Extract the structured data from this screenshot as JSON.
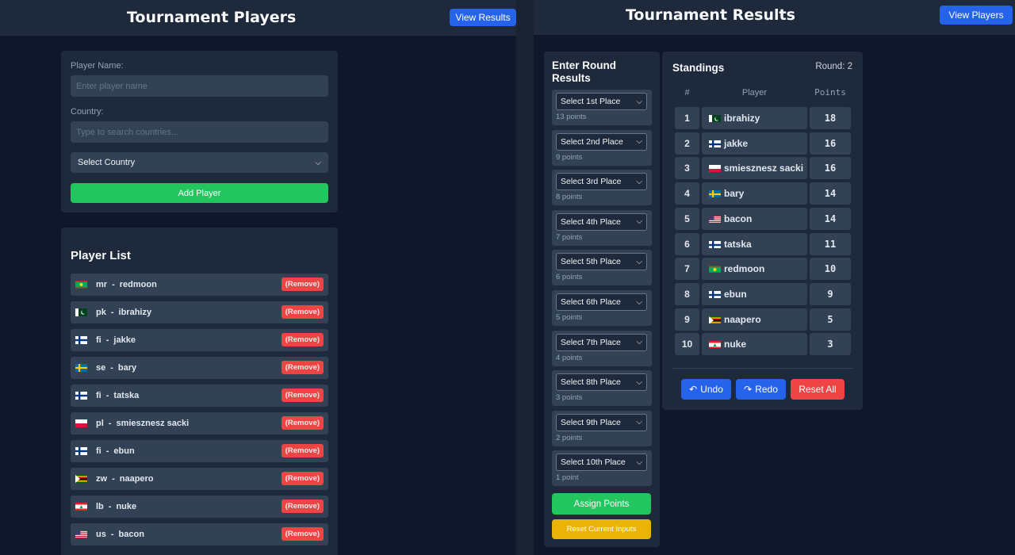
{
  "players_panel": {
    "title": "Tournament Players",
    "view_results_label": "View Results",
    "form": {
      "name_label": "Player Name:",
      "name_placeholder": "Enter player name",
      "country_label": "Country:",
      "country_search_placeholder": "Type to search countries...",
      "country_select_value": "Select Country",
      "add_button_label": "Add Player"
    },
    "list_title": "Player List",
    "remove_label": "(Remove)",
    "players": [
      {
        "code": "mr",
        "name": "redmoon",
        "flag": "mr"
      },
      {
        "code": "pk",
        "name": "ibrahizy",
        "flag": "pk"
      },
      {
        "code": "fi",
        "name": "jakke",
        "flag": "fi"
      },
      {
        "code": "se",
        "name": "bary",
        "flag": "se"
      },
      {
        "code": "fi",
        "name": "tatska",
        "flag": "fi"
      },
      {
        "code": "pl",
        "name": "smiesznesz sacki",
        "flag": "pl"
      },
      {
        "code": "fi",
        "name": "ebun",
        "flag": "fi"
      },
      {
        "code": "zw",
        "name": "naapero",
        "flag": "zw"
      },
      {
        "code": "lb",
        "name": "nuke",
        "flag": "lb"
      },
      {
        "code": "us",
        "name": "bacon",
        "flag": "us"
      }
    ]
  },
  "results_panel": {
    "title": "Tournament Results",
    "view_players_label": "View Players",
    "entry_title": "Enter Round Results",
    "places": [
      {
        "label": "Select 1st Place",
        "points": "13 points"
      },
      {
        "label": "Select 2nd Place",
        "points": "9 points"
      },
      {
        "label": "Select 3rd Place",
        "points": "8 points"
      },
      {
        "label": "Select 4th Place",
        "points": "7 points"
      },
      {
        "label": "Select 5th Place",
        "points": "6 points"
      },
      {
        "label": "Select 6th Place",
        "points": "5 points"
      },
      {
        "label": "Select 7th Place",
        "points": "4 points"
      },
      {
        "label": "Select 8th Place",
        "points": "3 points"
      },
      {
        "label": "Select 9th Place",
        "points": "2 points"
      },
      {
        "label": "Select 10th Place",
        "points": "1 point"
      }
    ],
    "assign_label": "Assign Points",
    "reset_inputs_label": "Reset Current Inputs",
    "standings": {
      "title": "Standings",
      "round_label": "Round: 2",
      "headers": {
        "rank": "#",
        "player": "Player",
        "points": "Points"
      },
      "rows": [
        {
          "rank": "1",
          "player": "ibrahizy",
          "flag": "pk",
          "points": "18"
        },
        {
          "rank": "2",
          "player": "jakke",
          "flag": "fi",
          "points": "16"
        },
        {
          "rank": "3",
          "player": "smiesznesz sacki",
          "flag": "pl",
          "points": "16"
        },
        {
          "rank": "4",
          "player": "bary",
          "flag": "se",
          "points": "14"
        },
        {
          "rank": "5",
          "player": "bacon",
          "flag": "us",
          "points": "14"
        },
        {
          "rank": "6",
          "player": "tatska",
          "flag": "fi",
          "points": "11"
        },
        {
          "rank": "7",
          "player": "redmoon",
          "flag": "mr",
          "points": "10"
        },
        {
          "rank": "8",
          "player": "ebun",
          "flag": "fi",
          "points": "9"
        },
        {
          "rank": "9",
          "player": "naapero",
          "flag": "zw",
          "points": "5"
        },
        {
          "rank": "10",
          "player": "nuke",
          "flag": "lb",
          "points": "3"
        }
      ],
      "undo_label": "Undo",
      "redo_label": "Redo",
      "reset_all_label": "Reset All"
    }
  },
  "colors": {
    "background": "#0f172a",
    "card": "#1e293b",
    "field": "#334155",
    "accent_blue": "#2563eb",
    "accent_green": "#22c55e",
    "accent_red": "#ef4444",
    "accent_yellow": "#eab308"
  }
}
